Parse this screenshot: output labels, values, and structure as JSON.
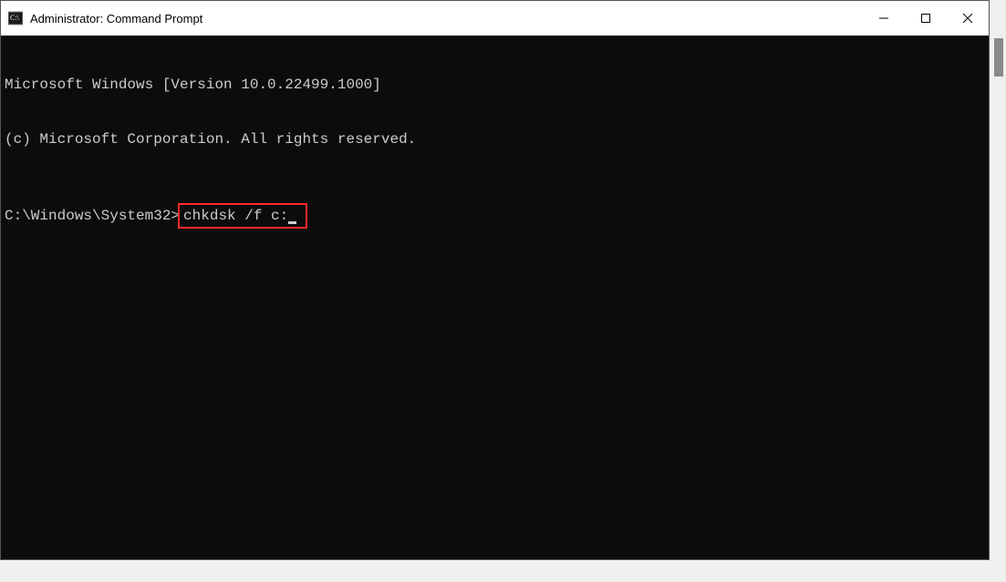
{
  "window": {
    "title": "Administrator: Command Prompt"
  },
  "terminal": {
    "line1": "Microsoft Windows [Version 10.0.22499.1000]",
    "line2": "(c) Microsoft Corporation. All rights reserved.",
    "prompt_path": "C:\\Windows\\System32>",
    "command": "chkdsk /f c:"
  }
}
